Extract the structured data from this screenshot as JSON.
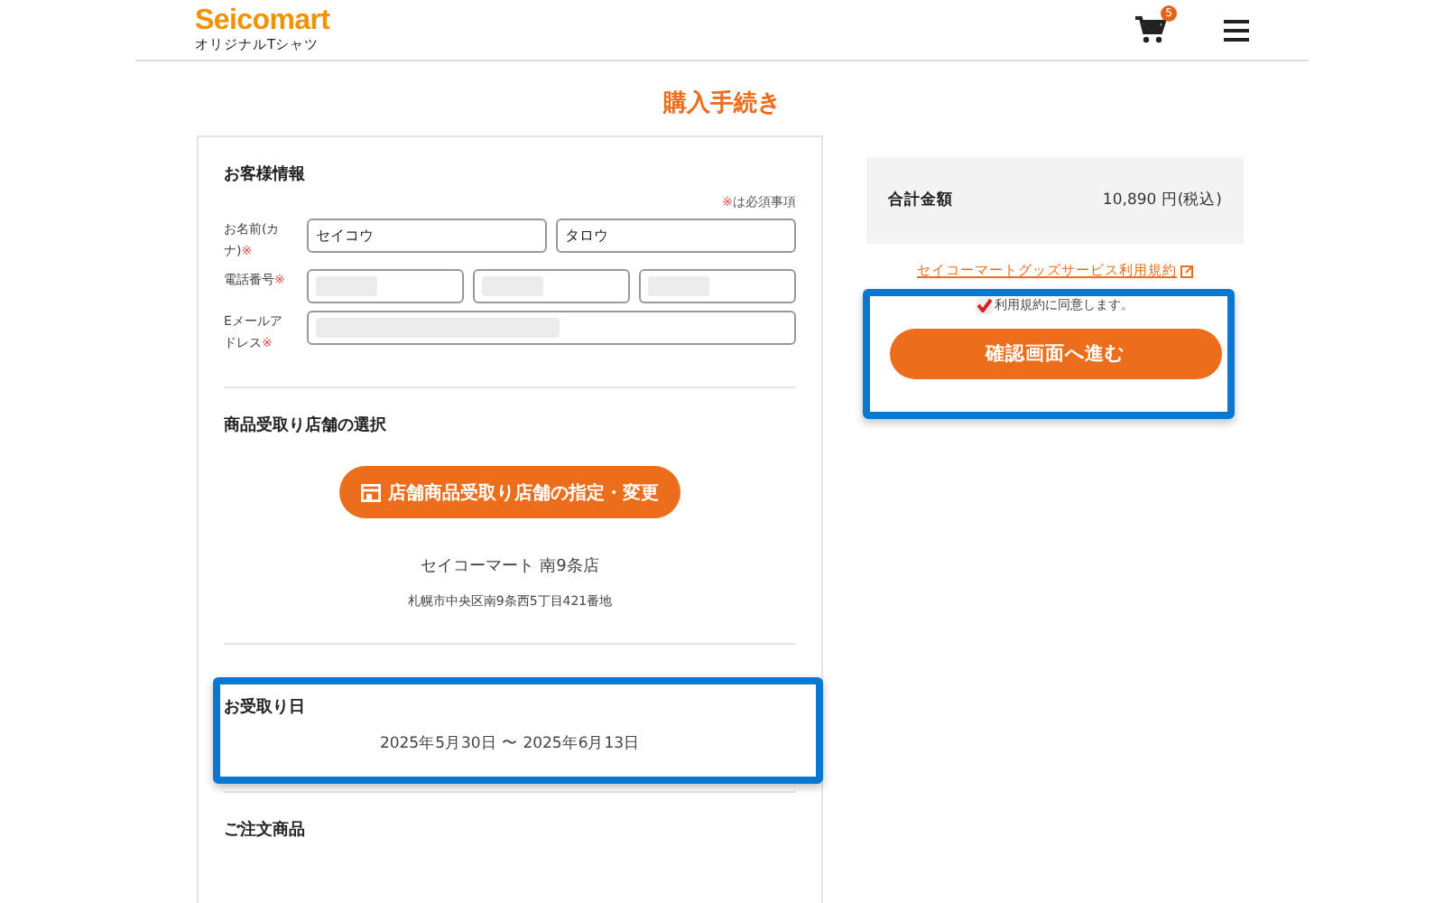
{
  "header": {
    "logo": "Seicomart",
    "logo_subtitle": "オリジナルTシャツ",
    "cart_count": "5"
  },
  "page_title": "購入手続き",
  "customer": {
    "heading": "お客様情報",
    "required_note_mark": "※",
    "required_note": "は必須事項",
    "rows": [
      {
        "label": "お名前(カナ)",
        "required": true,
        "fields": [
          {
            "value": "セイコウ",
            "blurred": false
          },
          {
            "value": "タロウ",
            "blurred": false
          }
        ]
      },
      {
        "label": "電話番号",
        "required": true,
        "fields": [
          {
            "blurred": true
          },
          {
            "blurred": true
          },
          {
            "blurred": true
          }
        ]
      },
      {
        "label": "Eメールアドレス",
        "required": true,
        "fields": [
          {
            "blurred": true
          }
        ]
      }
    ]
  },
  "store": {
    "heading": "商品受取り店舗の選択",
    "button": "店舗商品受取り店舗の指定・変更",
    "name": "セイコーマート 南9条店",
    "address": "札幌市中央区南9条西5丁目421番地"
  },
  "pickup": {
    "heading": "お受取り日",
    "dates": "2025年5月30日 〜 2025年6月13日",
    "highlighted": true
  },
  "order": {
    "heading": "ご注文商品"
  },
  "summary": {
    "total_label": "合計金額",
    "total_value": "10,890 円(税込)",
    "terms_link": "セイコーマートグッズサービス利用規約",
    "agree_label": "利用規約に同意します。",
    "agree_checked": true,
    "button": "確認画面へ進む",
    "highlighted": true
  }
}
